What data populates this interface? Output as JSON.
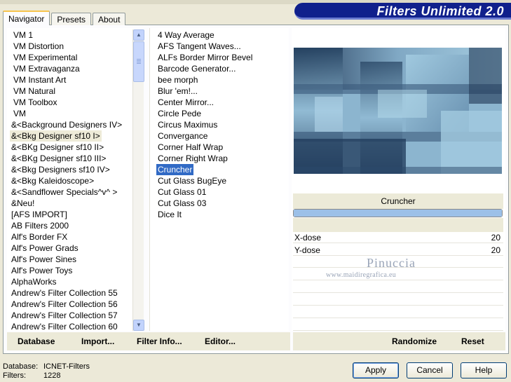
{
  "banner": {
    "title": "Filters Unlimited 2.0"
  },
  "tabs": [
    {
      "label": "Navigator",
      "active": true
    },
    {
      "label": "Presets",
      "active": false
    },
    {
      "label": "About",
      "active": false
    }
  ],
  "categories": [
    "VM 1",
    "VM Distortion",
    "VM Experimental",
    "VM Extravaganza",
    "VM Instant Art",
    "VM Natural",
    "VM Toolbox",
    "VM",
    "&<Background Designers IV>",
    "&<Bkg Designer sf10 I>",
    "&<BKg Designer sf10 II>",
    "&<BKg Designer sf10 III>",
    "&<Bkg Designers sf10 IV>",
    "&<Bkg Kaleidoscope>",
    "&<Sandflower Specials^v^ >",
    "&Neu!",
    "[AFS IMPORT]",
    "AB Filters 2000",
    "Alf's Border FX",
    "Alf's Power Grads",
    "Alf's Power Sines",
    "Alf's Power Toys",
    "AlphaWorks",
    "Andrew's Filter Collection 55",
    "Andrew's Filter Collection 56",
    "Andrew's Filter Collection 57",
    "Andrew's Filter Collection 60"
  ],
  "selected_category": "&<Bkg Designer sf10 I>",
  "filters": [
    "4 Way Average",
    "AFS Tangent Waves...",
    "ALFs Border Mirror Bevel",
    "Barcode Generator...",
    "bee morph",
    "Blur 'em!...",
    "Center Mirror...",
    "Circle Pede",
    "Circus Maximus",
    "Convergance",
    "Corner Half Wrap",
    "Corner Right Wrap",
    "Cruncher",
    "Cut Glass  BugEye",
    "Cut Glass 01",
    "Cut Glass 03",
    "Dice It"
  ],
  "selected_filter": "Cruncher",
  "preview": {
    "filter_name": "Cruncher",
    "progress": 1.0
  },
  "params": [
    {
      "label": "X-dose",
      "value": "20"
    },
    {
      "label": "Y-dose",
      "value": "20"
    }
  ],
  "watermark": {
    "name": "Pinuccia",
    "url": "www.maidiregrafica.eu"
  },
  "toolbar_left": {
    "database": "Database",
    "import": "Import...",
    "filter_info": "Filter Info...",
    "editor": "Editor..."
  },
  "toolbar_right": {
    "randomize": "Randomize",
    "reset": "Reset"
  },
  "status": {
    "database_label": "Database:",
    "database_value": "ICNET-Filters",
    "filters_label": "Filters:",
    "filters_value": "1228"
  },
  "buttons": {
    "apply": "Apply",
    "cancel": "Cancel",
    "help": "Help"
  },
  "colors": {
    "banner": "#10208c",
    "selection": "#316ac5",
    "category_selection": "#eeebd8",
    "panel": "#ecead8"
  },
  "icons": {
    "scroll_up": "chevron-up-icon",
    "scroll_down": "chevron-down-icon"
  }
}
